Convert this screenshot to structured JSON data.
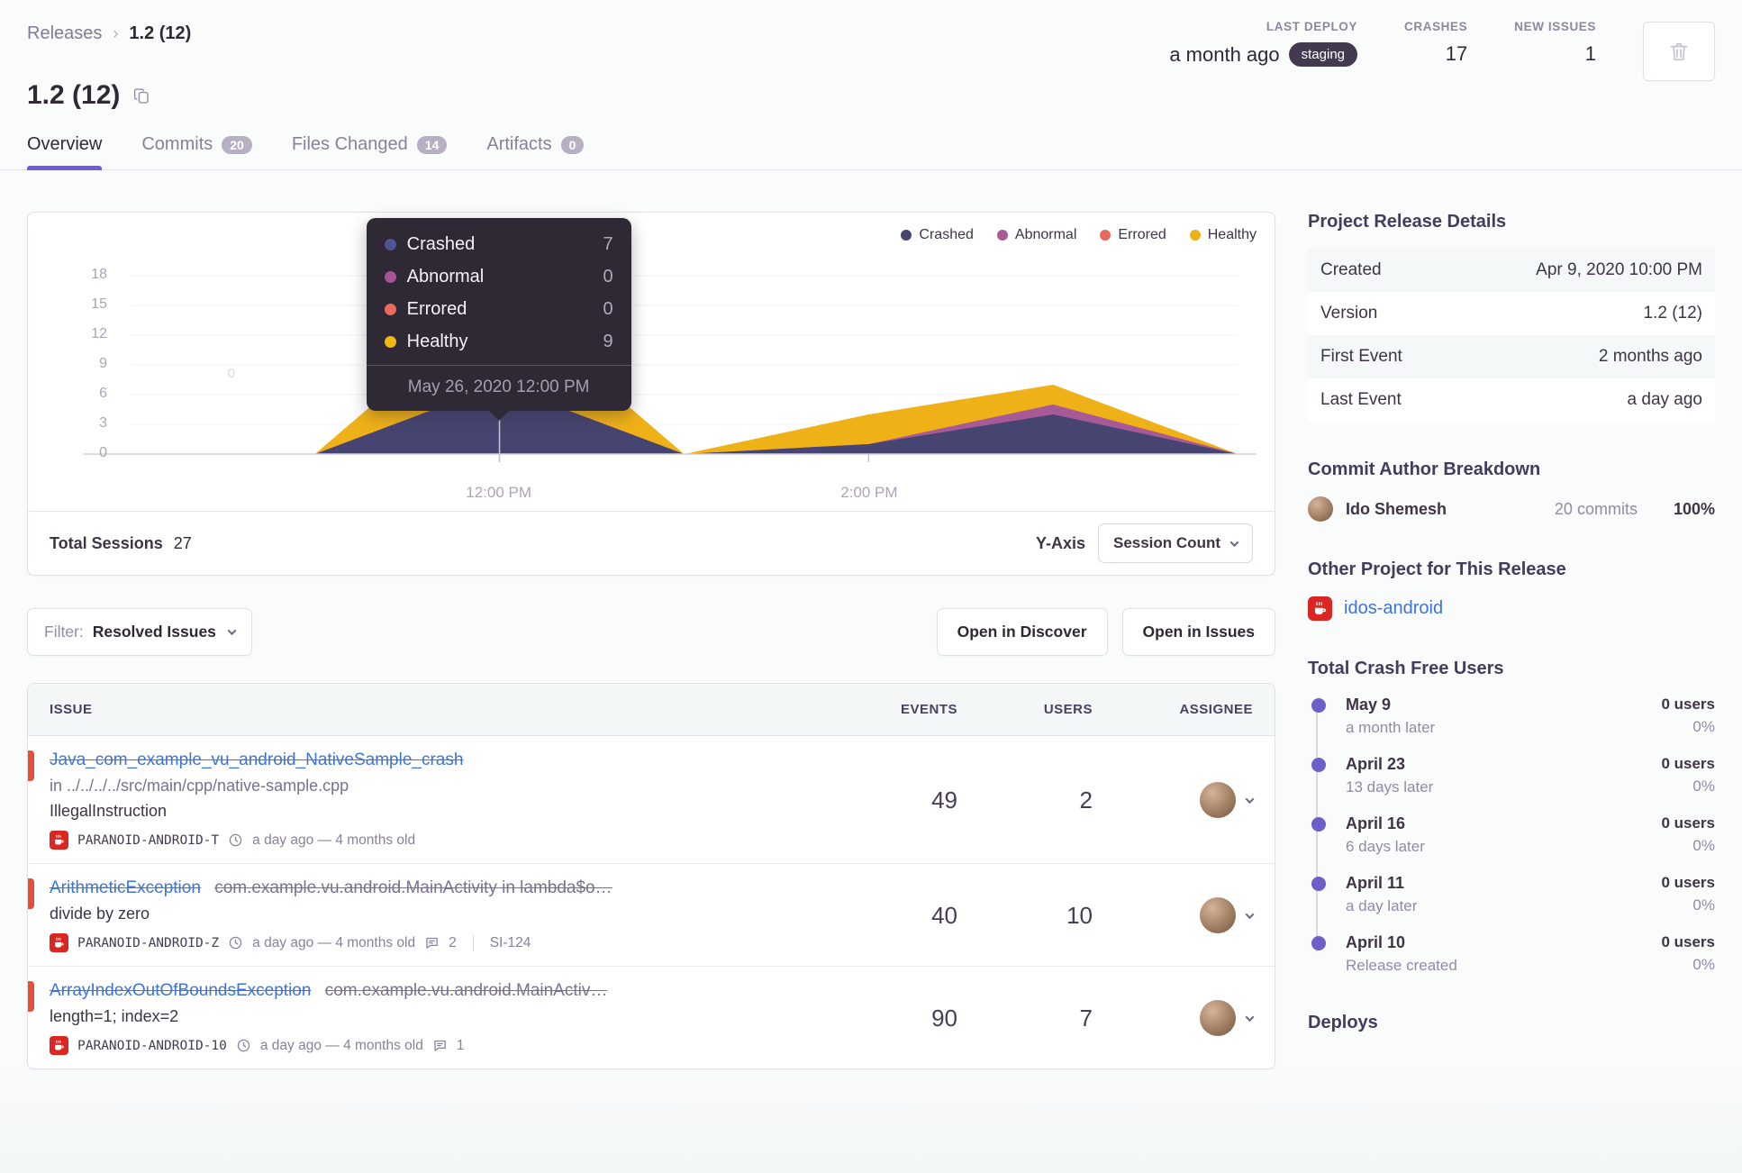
{
  "breadcrumb": {
    "parent": "Releases",
    "current": "1.2 (12)"
  },
  "header": {
    "stats": [
      {
        "label": "LAST DEPLOY",
        "value": "a month ago",
        "badge": "staging"
      },
      {
        "label": "CRASHES",
        "value": "17"
      },
      {
        "label": "NEW ISSUES",
        "value": "1"
      }
    ]
  },
  "title": "1.2 (12)",
  "tabs": [
    {
      "label": "Overview"
    },
    {
      "label": "Commits",
      "badge": "20"
    },
    {
      "label": "Files Changed",
      "badge": "14"
    },
    {
      "label": "Artifacts",
      "badge": "0"
    }
  ],
  "chart": {
    "y_ticks": [
      "18",
      "15",
      "12",
      "9",
      "6",
      "3",
      "0"
    ],
    "x_ticks": [
      "12:00 PM",
      "2:00 PM"
    ],
    "ghost_label": "0",
    "tooltip": {
      "rows": [
        {
          "label": "Crashed",
          "value": "7",
          "color": "#4E5496"
        },
        {
          "label": "Abnormal",
          "value": "0",
          "color": "#A6539A"
        },
        {
          "label": "Errored",
          "value": "0",
          "color": "#EC6A5B"
        },
        {
          "label": "Healthy",
          "value": "9",
          "color": "#F0B712"
        }
      ],
      "date": "May 26, 2020 12:00 PM"
    },
    "footer": {
      "total_label": "Total Sessions",
      "total_value": "27",
      "yaxis_label": "Y-Axis",
      "yaxis_button": "Session Count"
    }
  },
  "chart_data": {
    "type": "area",
    "stacked": true,
    "title": "Release sessions by status over time",
    "x": [
      "10:00 AM",
      "11:00 AM",
      "12:00 PM",
      "1:00 PM",
      "2:00 PM",
      "3:00 PM",
      "4:00 PM"
    ],
    "series": [
      {
        "name": "Crashed",
        "color": "#464571",
        "values": [
          0,
          0,
          7,
          0,
          1,
          4,
          0
        ]
      },
      {
        "name": "Abnormal",
        "color": "#A85A97",
        "values": [
          0,
          0,
          0,
          0,
          0,
          1,
          0
        ]
      },
      {
        "name": "Errored",
        "color": "#E9695D",
        "values": [
          0,
          0,
          0,
          0,
          0,
          0,
          0
        ]
      },
      {
        "name": "Healthy",
        "color": "#EFB118",
        "values": [
          0,
          0,
          9,
          0,
          3,
          2,
          0
        ]
      }
    ],
    "ylim": [
      0,
      18
    ],
    "y_tick_values": [
      0,
      3,
      6,
      9,
      12,
      15,
      18
    ],
    "x_tick_labels": [
      "12:00 PM",
      "2:00 PM"
    ],
    "legend_position": "top-right",
    "grid": true,
    "tooltip_point": {
      "date": "May 26, 2020 12:00 PM",
      "Crashed": 7,
      "Abnormal": 0,
      "Errored": 0,
      "Healthy": 9
    },
    "total_sessions": 27
  },
  "toolbar": {
    "filter_label": "Filter:",
    "filter_value": "Resolved Issues",
    "open_in_discover": "Open in Discover",
    "open_in_issues": "Open in Issues"
  },
  "issues": {
    "columns": {
      "issue": "ISSUE",
      "events": "EVENTS",
      "users": "USERS",
      "assignee": "ASSIGNEE"
    },
    "rows": [
      {
        "title": "Java_com_example_vu_android_NativeSample_crash",
        "culprit": "in ../../../../src/main/cpp/native-sample.cpp",
        "message": "IllegalInstruction",
        "project_tag": "PARANOID-ANDROID-T",
        "age": "a day ago — 4 months old",
        "events": "49",
        "users": "2"
      },
      {
        "title": "ArithmeticException",
        "culprit": "com.example.vu.android.MainActivity in lambda$o…",
        "message": "divide by zero",
        "project_tag": "PARANOID-ANDROID-Z",
        "age": "a day ago — 4 months old",
        "comments": "2",
        "short_id": "SI-124",
        "events": "40",
        "users": "10"
      },
      {
        "title": "ArrayIndexOutOfBoundsException",
        "culprit": "com.example.vu.android.MainActiv…",
        "message": "length=1; index=2",
        "project_tag": "PARANOID-ANDROID-10",
        "age": "a day ago — 4 months old",
        "comments": "1",
        "events": "90",
        "users": "7"
      }
    ]
  },
  "sidebar": {
    "details": {
      "heading": "Project Release Details",
      "rows": [
        {
          "label": "Created",
          "value": "Apr 9, 2020 10:00 PM"
        },
        {
          "label": "Version",
          "value": "1.2 (12)"
        },
        {
          "label": "First Event",
          "value": "2 months ago"
        },
        {
          "label": "Last Event",
          "value": "a day ago"
        }
      ]
    },
    "authors": {
      "heading": "Commit Author Breakdown",
      "name": "Ido Shemesh",
      "commits": "20 commits",
      "percent": "100%"
    },
    "other_project": {
      "heading": "Other Project for This Release",
      "link": "idos-android"
    },
    "crash_free": {
      "heading": "Total Crash Free Users",
      "entries": [
        {
          "date": "May 9",
          "sub": "a month later",
          "users": "0 users",
          "pct": "0%"
        },
        {
          "date": "April 23",
          "sub": "13 days later",
          "users": "0 users",
          "pct": "0%"
        },
        {
          "date": "April 16",
          "sub": "6 days later",
          "users": "0 users",
          "pct": "0%"
        },
        {
          "date": "April 11",
          "sub": "a day later",
          "users": "0 users",
          "pct": "0%"
        },
        {
          "date": "April 10",
          "sub": "Release created",
          "users": "0 users",
          "pct": "0%"
        }
      ]
    },
    "deploys_heading": "Deploys"
  }
}
